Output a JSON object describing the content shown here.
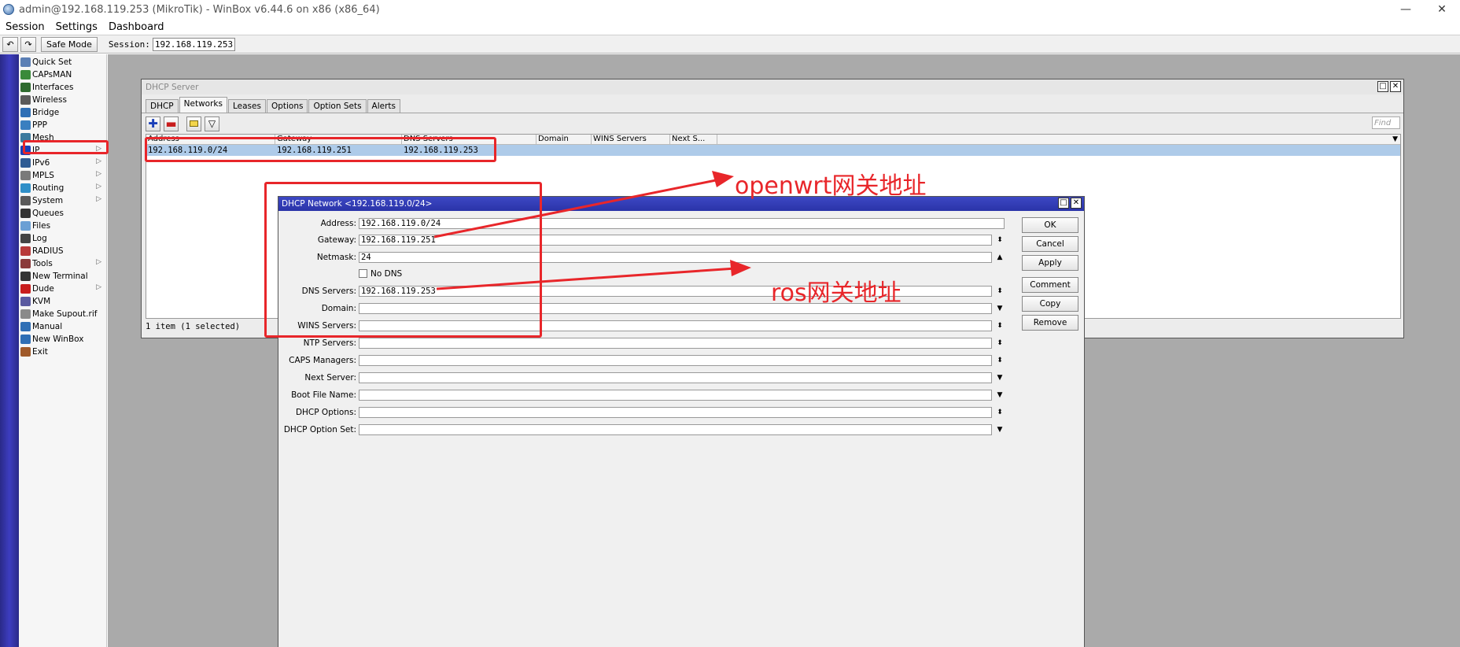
{
  "window": {
    "title": "admin@192.168.119.253 (MikroTik) - WinBox v6.44.6 on x86 (x86_64)",
    "min": "—",
    "close": "✕"
  },
  "menu": {
    "items": [
      "Session",
      "Settings",
      "Dashboard"
    ]
  },
  "toolbar": {
    "undo": "↶",
    "redo": "↷",
    "safe_mode": "Safe Mode",
    "session_label": "Session:",
    "session_value": "192.168.119.253"
  },
  "sidebar": {
    "items": [
      {
        "label": "Quick Set",
        "arrow": false
      },
      {
        "label": "CAPsMAN",
        "arrow": false
      },
      {
        "label": "Interfaces",
        "arrow": false
      },
      {
        "label": "Wireless",
        "arrow": false
      },
      {
        "label": "Bridge",
        "arrow": false
      },
      {
        "label": "PPP",
        "arrow": false
      },
      {
        "label": "Mesh",
        "arrow": false
      },
      {
        "label": "IP",
        "arrow": true
      },
      {
        "label": "IPv6",
        "arrow": true
      },
      {
        "label": "MPLS",
        "arrow": true
      },
      {
        "label": "Routing",
        "arrow": true
      },
      {
        "label": "System",
        "arrow": true
      },
      {
        "label": "Queues",
        "arrow": false
      },
      {
        "label": "Files",
        "arrow": false
      },
      {
        "label": "Log",
        "arrow": false
      },
      {
        "label": "RADIUS",
        "arrow": false
      },
      {
        "label": "Tools",
        "arrow": true
      },
      {
        "label": "New Terminal",
        "arrow": false
      },
      {
        "label": "Dude",
        "arrow": true
      },
      {
        "label": "KVM",
        "arrow": false
      },
      {
        "label": "Make Supout.rif",
        "arrow": false
      },
      {
        "label": "Manual",
        "arrow": false
      },
      {
        "label": "New WinBox",
        "arrow": false
      },
      {
        "label": "Exit",
        "arrow": false
      }
    ],
    "arrow_glyph": "▷"
  },
  "dhcp_server": {
    "title": "DHCP Server",
    "tabs": [
      "DHCP",
      "Networks",
      "Leases",
      "Options",
      "Option Sets",
      "Alerts"
    ],
    "active_tab": "Networks",
    "find_placeholder": "Find",
    "columns": [
      "Address",
      "Gateway",
      "DNS Servers",
      "Domain",
      "WINS Servers",
      "Next S..."
    ],
    "rows": [
      [
        "192.168.119.0/24",
        "192.168.119.251",
        "192.168.119.253",
        "",
        "",
        ""
      ]
    ],
    "status": "1 item (1 selected)"
  },
  "dhcp_network": {
    "title": "DHCP Network <192.168.119.0/24>",
    "fields": {
      "address": {
        "label": "Address:",
        "value": "192.168.119.0/24"
      },
      "gateway": {
        "label": "Gateway:",
        "value": "192.168.119.251"
      },
      "netmask": {
        "label": "Netmask:",
        "value": "24"
      },
      "no_dns": {
        "label": "No DNS",
        "checked": false
      },
      "dns_servers": {
        "label": "DNS Servers:",
        "value": "192.168.119.253"
      },
      "domain": {
        "label": "Domain:",
        "value": ""
      },
      "wins_servers": {
        "label": "WINS Servers:",
        "value": ""
      },
      "ntp_servers": {
        "label": "NTP Servers:",
        "value": ""
      },
      "caps_managers": {
        "label": "CAPS Managers:",
        "value": ""
      },
      "next_server": {
        "label": "Next Server:",
        "value": ""
      },
      "boot_file_name": {
        "label": "Boot File Name:",
        "value": ""
      },
      "dhcp_options": {
        "label": "DHCP Options:",
        "value": ""
      },
      "dhcp_option_set": {
        "label": "DHCP Option Set:",
        "value": ""
      }
    },
    "buttons": [
      "OK",
      "Cancel",
      "Apply",
      "Comment",
      "Copy",
      "Remove"
    ]
  },
  "annotations": {
    "openwrt": "openwrt网关地址",
    "ros": "ros网关地址",
    "color": "#e8262a"
  }
}
